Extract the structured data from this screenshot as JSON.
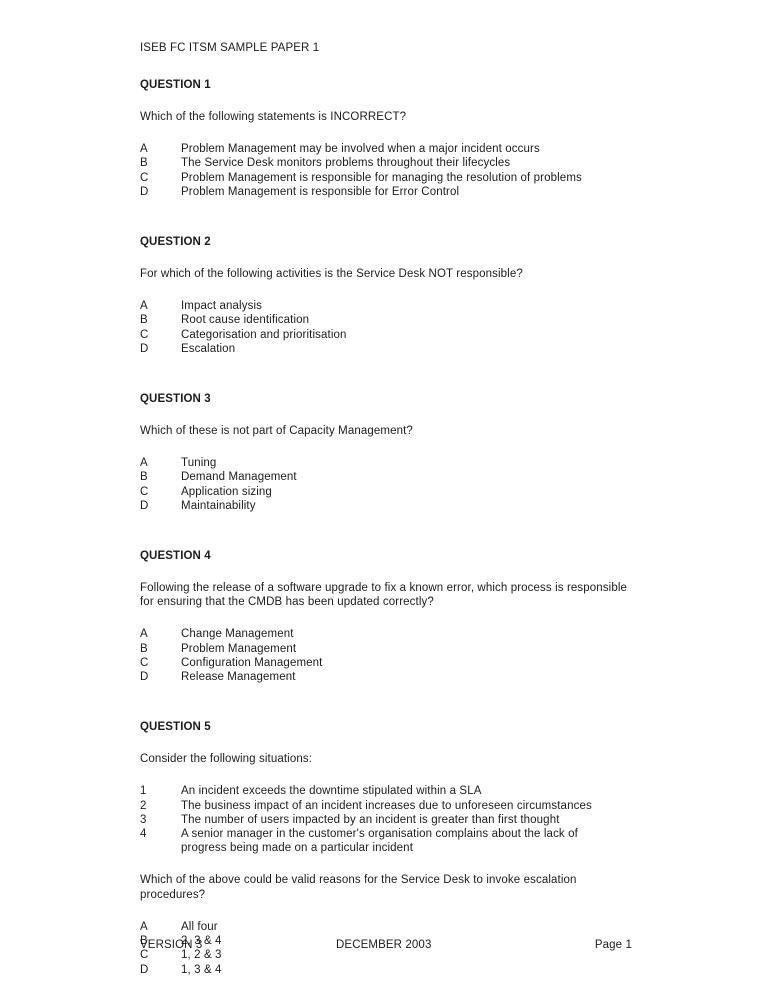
{
  "document": {
    "title": "ISEB FC ITSM SAMPLE PAPER 1"
  },
  "questions": [
    {
      "heading": "QUESTION 1",
      "stem": "Which of the following statements is INCORRECT?",
      "options": [
        {
          "key": "A",
          "text": "Problem Management may be involved when a major incident occurs"
        },
        {
          "key": "B",
          "text": "The Service Desk monitors problems throughout their lifecycles"
        },
        {
          "key": "C",
          "text": "Problem Management is responsible for managing the resolution of problems"
        },
        {
          "key": "D",
          "text": "Problem Management is responsible for Error Control"
        }
      ]
    },
    {
      "heading": "QUESTION 2",
      "stem": "For which of the following activities is the Service Desk NOT responsible?",
      "options": [
        {
          "key": "A",
          "text": "Impact analysis"
        },
        {
          "key": "B",
          "text": "Root cause identification"
        },
        {
          "key": "C",
          "text": "Categorisation and prioritisation"
        },
        {
          "key": "D",
          "text": "Escalation"
        }
      ]
    },
    {
      "heading": "QUESTION 3",
      "stem": "Which of these is not part of Capacity Management?",
      "options": [
        {
          "key": "A",
          "text": "Tuning"
        },
        {
          "key": "B",
          "text": "Demand Management"
        },
        {
          "key": "C",
          "text": "Application sizing"
        },
        {
          "key": "D",
          "text": "Maintainability"
        }
      ]
    },
    {
      "heading": "QUESTION 4",
      "stem": "Following the release of a software upgrade to fix a known error, which process is responsible for ensuring that the CMDB has been updated correctly?",
      "options": [
        {
          "key": "A",
          "text": "Change Management"
        },
        {
          "key": "B",
          "text": "Problem Management"
        },
        {
          "key": "C",
          "text": "Configuration Management"
        },
        {
          "key": "D",
          "text": "Release Management"
        }
      ]
    },
    {
      "heading": "QUESTION 5",
      "stem": "Consider the following situations:",
      "situations": [
        {
          "key": "1",
          "text": "An incident exceeds the downtime stipulated within a SLA"
        },
        {
          "key": "2",
          "text": "The business impact of an incident increases due to unforeseen circumstances"
        },
        {
          "key": "3",
          "text": "The number of users impacted by an incident is greater than first thought"
        },
        {
          "key": "4",
          "text": "A senior manager in the customer's organisation complains about the lack of",
          "cont": "progress being made on a particular incident"
        }
      ],
      "stem2": "Which of the above could be valid reasons for the Service Desk to invoke escalation procedures?",
      "options": [
        {
          "key": "A",
          "text": "All four"
        },
        {
          "key": "B",
          "text": "2, 3 & 4"
        },
        {
          "key": "C",
          "text": "1, 2 & 3"
        },
        {
          "key": "D",
          "text": "1, 3 & 4"
        }
      ]
    }
  ],
  "footer": {
    "version": "VERSION 3",
    "date": "DECEMBER 2003",
    "page": "Page 1"
  }
}
